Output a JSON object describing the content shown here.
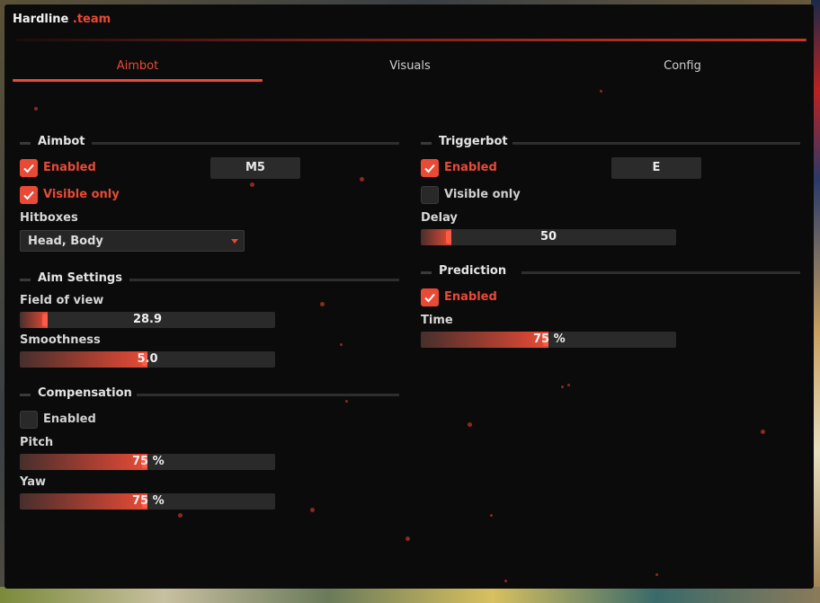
{
  "app": {
    "title": "Hardline",
    "title_accent": ".team"
  },
  "tabs": [
    {
      "label": "Aimbot",
      "active": true
    },
    {
      "label": "Visuals",
      "active": false
    },
    {
      "label": "Config",
      "active": false
    }
  ],
  "accent_color": "#e84a36",
  "left": {
    "aimbot": {
      "title": "Aimbot",
      "enabled": {
        "label": "Enabled",
        "checked": true
      },
      "key": "M5",
      "visible_only": {
        "label": "Visible only",
        "checked": true
      },
      "hitboxes_label": "Hitboxes",
      "hitboxes_value": "Head, Body"
    },
    "aim_settings": {
      "title": "Aim Settings",
      "fov_label": "Field of view",
      "fov_value": "28.9",
      "fov_fill": 0.11,
      "smooth_label": "Smoothness",
      "smooth_value": "5.0",
      "smooth_fill": 0.5
    },
    "compensation": {
      "title": "Compensation",
      "enabled": {
        "label": "Enabled",
        "checked": false
      },
      "pitch_label": "Pitch",
      "pitch_value": "75",
      "pitch_fill": 0.5,
      "yaw_label": "Yaw",
      "yaw_value": "75",
      "yaw_fill": 0.5,
      "unit": "%"
    }
  },
  "right": {
    "triggerbot": {
      "title": "Triggerbot",
      "enabled": {
        "label": "Enabled",
        "checked": true
      },
      "key": "E",
      "visible_only": {
        "label": "Visible only",
        "checked": false
      },
      "delay_label": "Delay",
      "delay_value": "50",
      "delay_fill": 0.12
    },
    "prediction": {
      "title": "Prediction",
      "enabled": {
        "label": "Enabled",
        "checked": true
      },
      "time_label": "Time",
      "time_value": "75",
      "time_fill": 0.5,
      "unit": "%"
    }
  }
}
